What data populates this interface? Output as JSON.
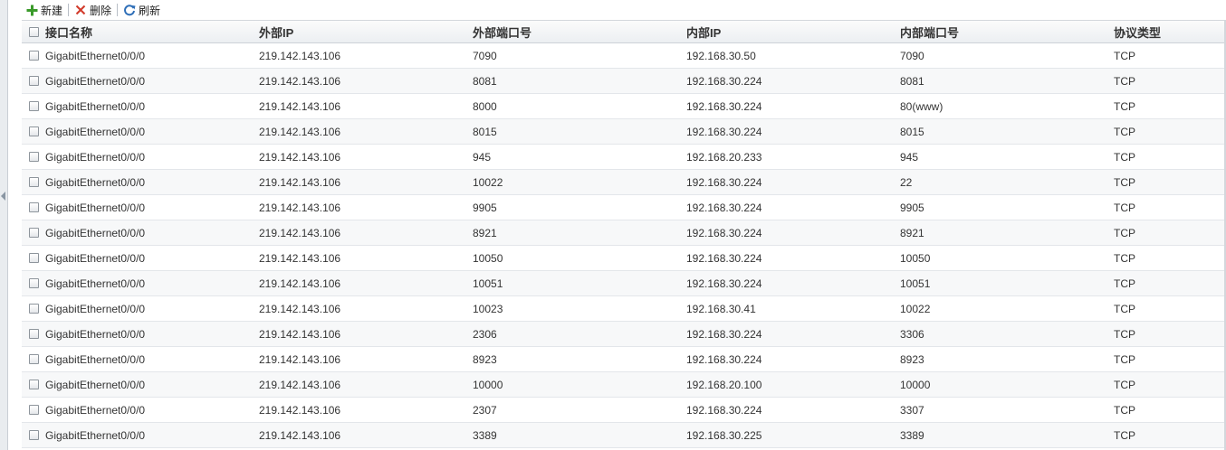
{
  "toolbar": {
    "new_label": "新建",
    "delete_label": "删除",
    "refresh_label": "刷新"
  },
  "columns": [
    "接口名称",
    "外部IP",
    "外部端口号",
    "内部IP",
    "内部端口号",
    "协议类型"
  ],
  "rows": [
    [
      "GigabitEthernet0/0/0",
      "219.142.143.106",
      "7090",
      "192.168.30.50",
      "7090",
      "TCP"
    ],
    [
      "GigabitEthernet0/0/0",
      "219.142.143.106",
      "8081",
      "192.168.30.224",
      "8081",
      "TCP"
    ],
    [
      "GigabitEthernet0/0/0",
      "219.142.143.106",
      "8000",
      "192.168.30.224",
      "80(www)",
      "TCP"
    ],
    [
      "GigabitEthernet0/0/0",
      "219.142.143.106",
      "8015",
      "192.168.30.224",
      "8015",
      "TCP"
    ],
    [
      "GigabitEthernet0/0/0",
      "219.142.143.106",
      "945",
      "192.168.20.233",
      "945",
      "TCP"
    ],
    [
      "GigabitEthernet0/0/0",
      "219.142.143.106",
      "10022",
      "192.168.30.224",
      "22",
      "TCP"
    ],
    [
      "GigabitEthernet0/0/0",
      "219.142.143.106",
      "9905",
      "192.168.30.224",
      "9905",
      "TCP"
    ],
    [
      "GigabitEthernet0/0/0",
      "219.142.143.106",
      "8921",
      "192.168.30.224",
      "8921",
      "TCP"
    ],
    [
      "GigabitEthernet0/0/0",
      "219.142.143.106",
      "10050",
      "192.168.30.224",
      "10050",
      "TCP"
    ],
    [
      "GigabitEthernet0/0/0",
      "219.142.143.106",
      "10051",
      "192.168.30.224",
      "10051",
      "TCP"
    ],
    [
      "GigabitEthernet0/0/0",
      "219.142.143.106",
      "10023",
      "192.168.30.41",
      "10022",
      "TCP"
    ],
    [
      "GigabitEthernet0/0/0",
      "219.142.143.106",
      "2306",
      "192.168.30.224",
      "3306",
      "TCP"
    ],
    [
      "GigabitEthernet0/0/0",
      "219.142.143.106",
      "8923",
      "192.168.30.224",
      "8923",
      "TCP"
    ],
    [
      "GigabitEthernet0/0/0",
      "219.142.143.106",
      "10000",
      "192.168.20.100",
      "10000",
      "TCP"
    ],
    [
      "GigabitEthernet0/0/0",
      "219.142.143.106",
      "2307",
      "192.168.30.224",
      "3307",
      "TCP"
    ],
    [
      "GigabitEthernet0/0/0",
      "219.142.143.106",
      "3389",
      "192.168.30.225",
      "3389",
      "TCP"
    ]
  ],
  "colors": {
    "add_icon": "#3a9a2a",
    "delete_icon": "#d23a2a",
    "refresh_icon": "#2f6fb8"
  }
}
